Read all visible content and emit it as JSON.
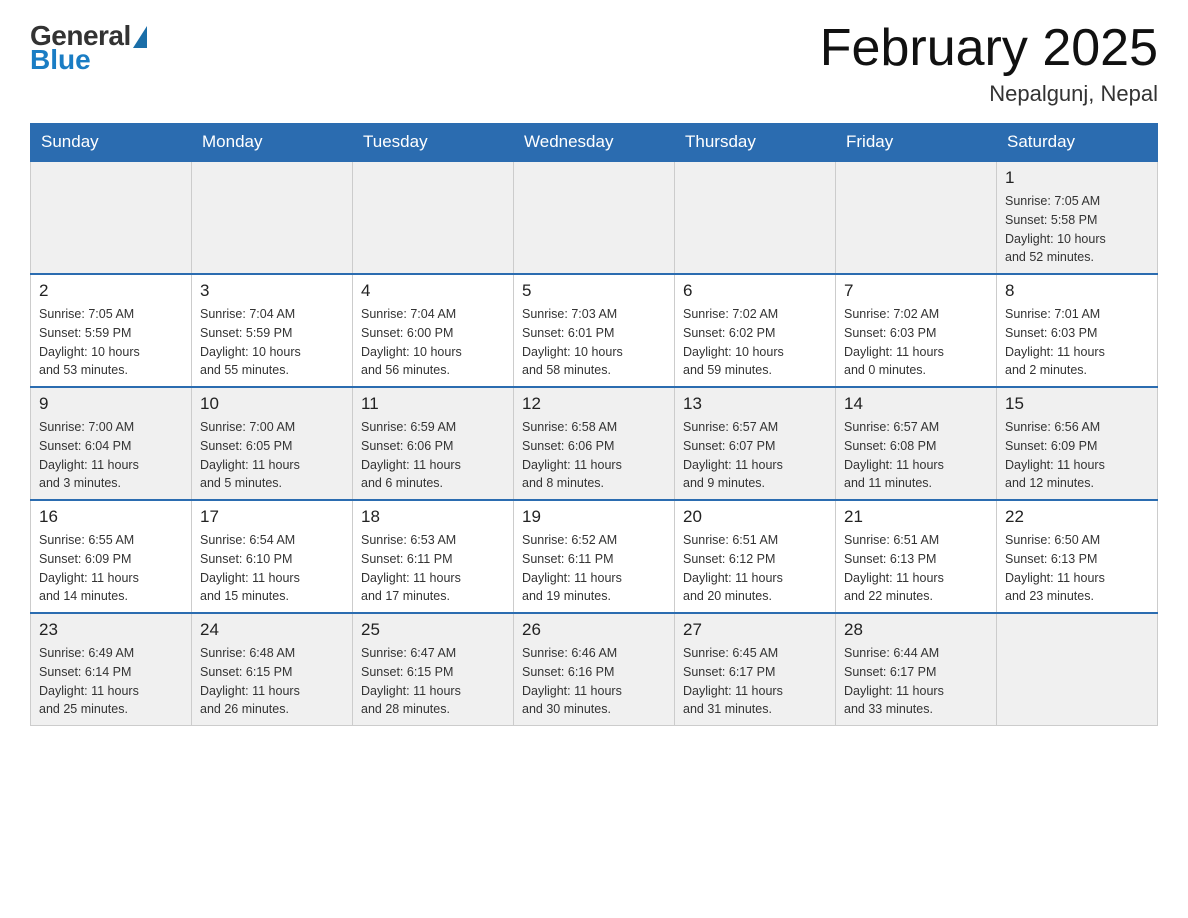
{
  "header": {
    "logo_general": "General",
    "logo_blue": "Blue",
    "title": "February 2025",
    "subtitle": "Nepalgunj, Nepal"
  },
  "days_of_week": [
    "Sunday",
    "Monday",
    "Tuesday",
    "Wednesday",
    "Thursday",
    "Friday",
    "Saturday"
  ],
  "weeks": [
    {
      "id": "week1",
      "days": [
        {
          "date": "",
          "info": ""
        },
        {
          "date": "",
          "info": ""
        },
        {
          "date": "",
          "info": ""
        },
        {
          "date": "",
          "info": ""
        },
        {
          "date": "",
          "info": ""
        },
        {
          "date": "",
          "info": ""
        },
        {
          "date": "1",
          "info": "Sunrise: 7:05 AM\nSunset: 5:58 PM\nDaylight: 10 hours\nand 52 minutes."
        }
      ]
    },
    {
      "id": "week2",
      "days": [
        {
          "date": "2",
          "info": "Sunrise: 7:05 AM\nSunset: 5:59 PM\nDaylight: 10 hours\nand 53 minutes."
        },
        {
          "date": "3",
          "info": "Sunrise: 7:04 AM\nSunset: 5:59 PM\nDaylight: 10 hours\nand 55 minutes."
        },
        {
          "date": "4",
          "info": "Sunrise: 7:04 AM\nSunset: 6:00 PM\nDaylight: 10 hours\nand 56 minutes."
        },
        {
          "date": "5",
          "info": "Sunrise: 7:03 AM\nSunset: 6:01 PM\nDaylight: 10 hours\nand 58 minutes."
        },
        {
          "date": "6",
          "info": "Sunrise: 7:02 AM\nSunset: 6:02 PM\nDaylight: 10 hours\nand 59 minutes."
        },
        {
          "date": "7",
          "info": "Sunrise: 7:02 AM\nSunset: 6:03 PM\nDaylight: 11 hours\nand 0 minutes."
        },
        {
          "date": "8",
          "info": "Sunrise: 7:01 AM\nSunset: 6:03 PM\nDaylight: 11 hours\nand 2 minutes."
        }
      ]
    },
    {
      "id": "week3",
      "days": [
        {
          "date": "9",
          "info": "Sunrise: 7:00 AM\nSunset: 6:04 PM\nDaylight: 11 hours\nand 3 minutes."
        },
        {
          "date": "10",
          "info": "Sunrise: 7:00 AM\nSunset: 6:05 PM\nDaylight: 11 hours\nand 5 minutes."
        },
        {
          "date": "11",
          "info": "Sunrise: 6:59 AM\nSunset: 6:06 PM\nDaylight: 11 hours\nand 6 minutes."
        },
        {
          "date": "12",
          "info": "Sunrise: 6:58 AM\nSunset: 6:06 PM\nDaylight: 11 hours\nand 8 minutes."
        },
        {
          "date": "13",
          "info": "Sunrise: 6:57 AM\nSunset: 6:07 PM\nDaylight: 11 hours\nand 9 minutes."
        },
        {
          "date": "14",
          "info": "Sunrise: 6:57 AM\nSunset: 6:08 PM\nDaylight: 11 hours\nand 11 minutes."
        },
        {
          "date": "15",
          "info": "Sunrise: 6:56 AM\nSunset: 6:09 PM\nDaylight: 11 hours\nand 12 minutes."
        }
      ]
    },
    {
      "id": "week4",
      "days": [
        {
          "date": "16",
          "info": "Sunrise: 6:55 AM\nSunset: 6:09 PM\nDaylight: 11 hours\nand 14 minutes."
        },
        {
          "date": "17",
          "info": "Sunrise: 6:54 AM\nSunset: 6:10 PM\nDaylight: 11 hours\nand 15 minutes."
        },
        {
          "date": "18",
          "info": "Sunrise: 6:53 AM\nSunset: 6:11 PM\nDaylight: 11 hours\nand 17 minutes."
        },
        {
          "date": "19",
          "info": "Sunrise: 6:52 AM\nSunset: 6:11 PM\nDaylight: 11 hours\nand 19 minutes."
        },
        {
          "date": "20",
          "info": "Sunrise: 6:51 AM\nSunset: 6:12 PM\nDaylight: 11 hours\nand 20 minutes."
        },
        {
          "date": "21",
          "info": "Sunrise: 6:51 AM\nSunset: 6:13 PM\nDaylight: 11 hours\nand 22 minutes."
        },
        {
          "date": "22",
          "info": "Sunrise: 6:50 AM\nSunset: 6:13 PM\nDaylight: 11 hours\nand 23 minutes."
        }
      ]
    },
    {
      "id": "week5",
      "days": [
        {
          "date": "23",
          "info": "Sunrise: 6:49 AM\nSunset: 6:14 PM\nDaylight: 11 hours\nand 25 minutes."
        },
        {
          "date": "24",
          "info": "Sunrise: 6:48 AM\nSunset: 6:15 PM\nDaylight: 11 hours\nand 26 minutes."
        },
        {
          "date": "25",
          "info": "Sunrise: 6:47 AM\nSunset: 6:15 PM\nDaylight: 11 hours\nand 28 minutes."
        },
        {
          "date": "26",
          "info": "Sunrise: 6:46 AM\nSunset: 6:16 PM\nDaylight: 11 hours\nand 30 minutes."
        },
        {
          "date": "27",
          "info": "Sunrise: 6:45 AM\nSunset: 6:17 PM\nDaylight: 11 hours\nand 31 minutes."
        },
        {
          "date": "28",
          "info": "Sunrise: 6:44 AM\nSunset: 6:17 PM\nDaylight: 11 hours\nand 33 minutes."
        },
        {
          "date": "",
          "info": ""
        }
      ]
    }
  ]
}
